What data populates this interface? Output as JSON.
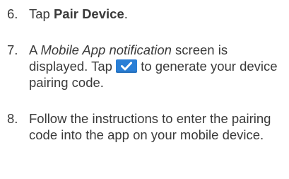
{
  "steps": [
    {
      "number": "6.",
      "text_before": "Tap ",
      "emphasis": "Pair Device",
      "text_after": "."
    },
    {
      "number": "7.",
      "text_before": "A ",
      "emphasis": "Mobile App notification",
      "text_middle": " screen is displayed. Tap ",
      "icon": "checkmark-button-icon",
      "text_after": " to generate your device pairing code."
    },
    {
      "number": "8.",
      "text": "Follow the instructions to enter the pairing code into the app on your mobile device."
    }
  ],
  "colors": {
    "text": "#3a3a3a",
    "button": "#2a7fd6",
    "checkmark": "#ffffff"
  }
}
